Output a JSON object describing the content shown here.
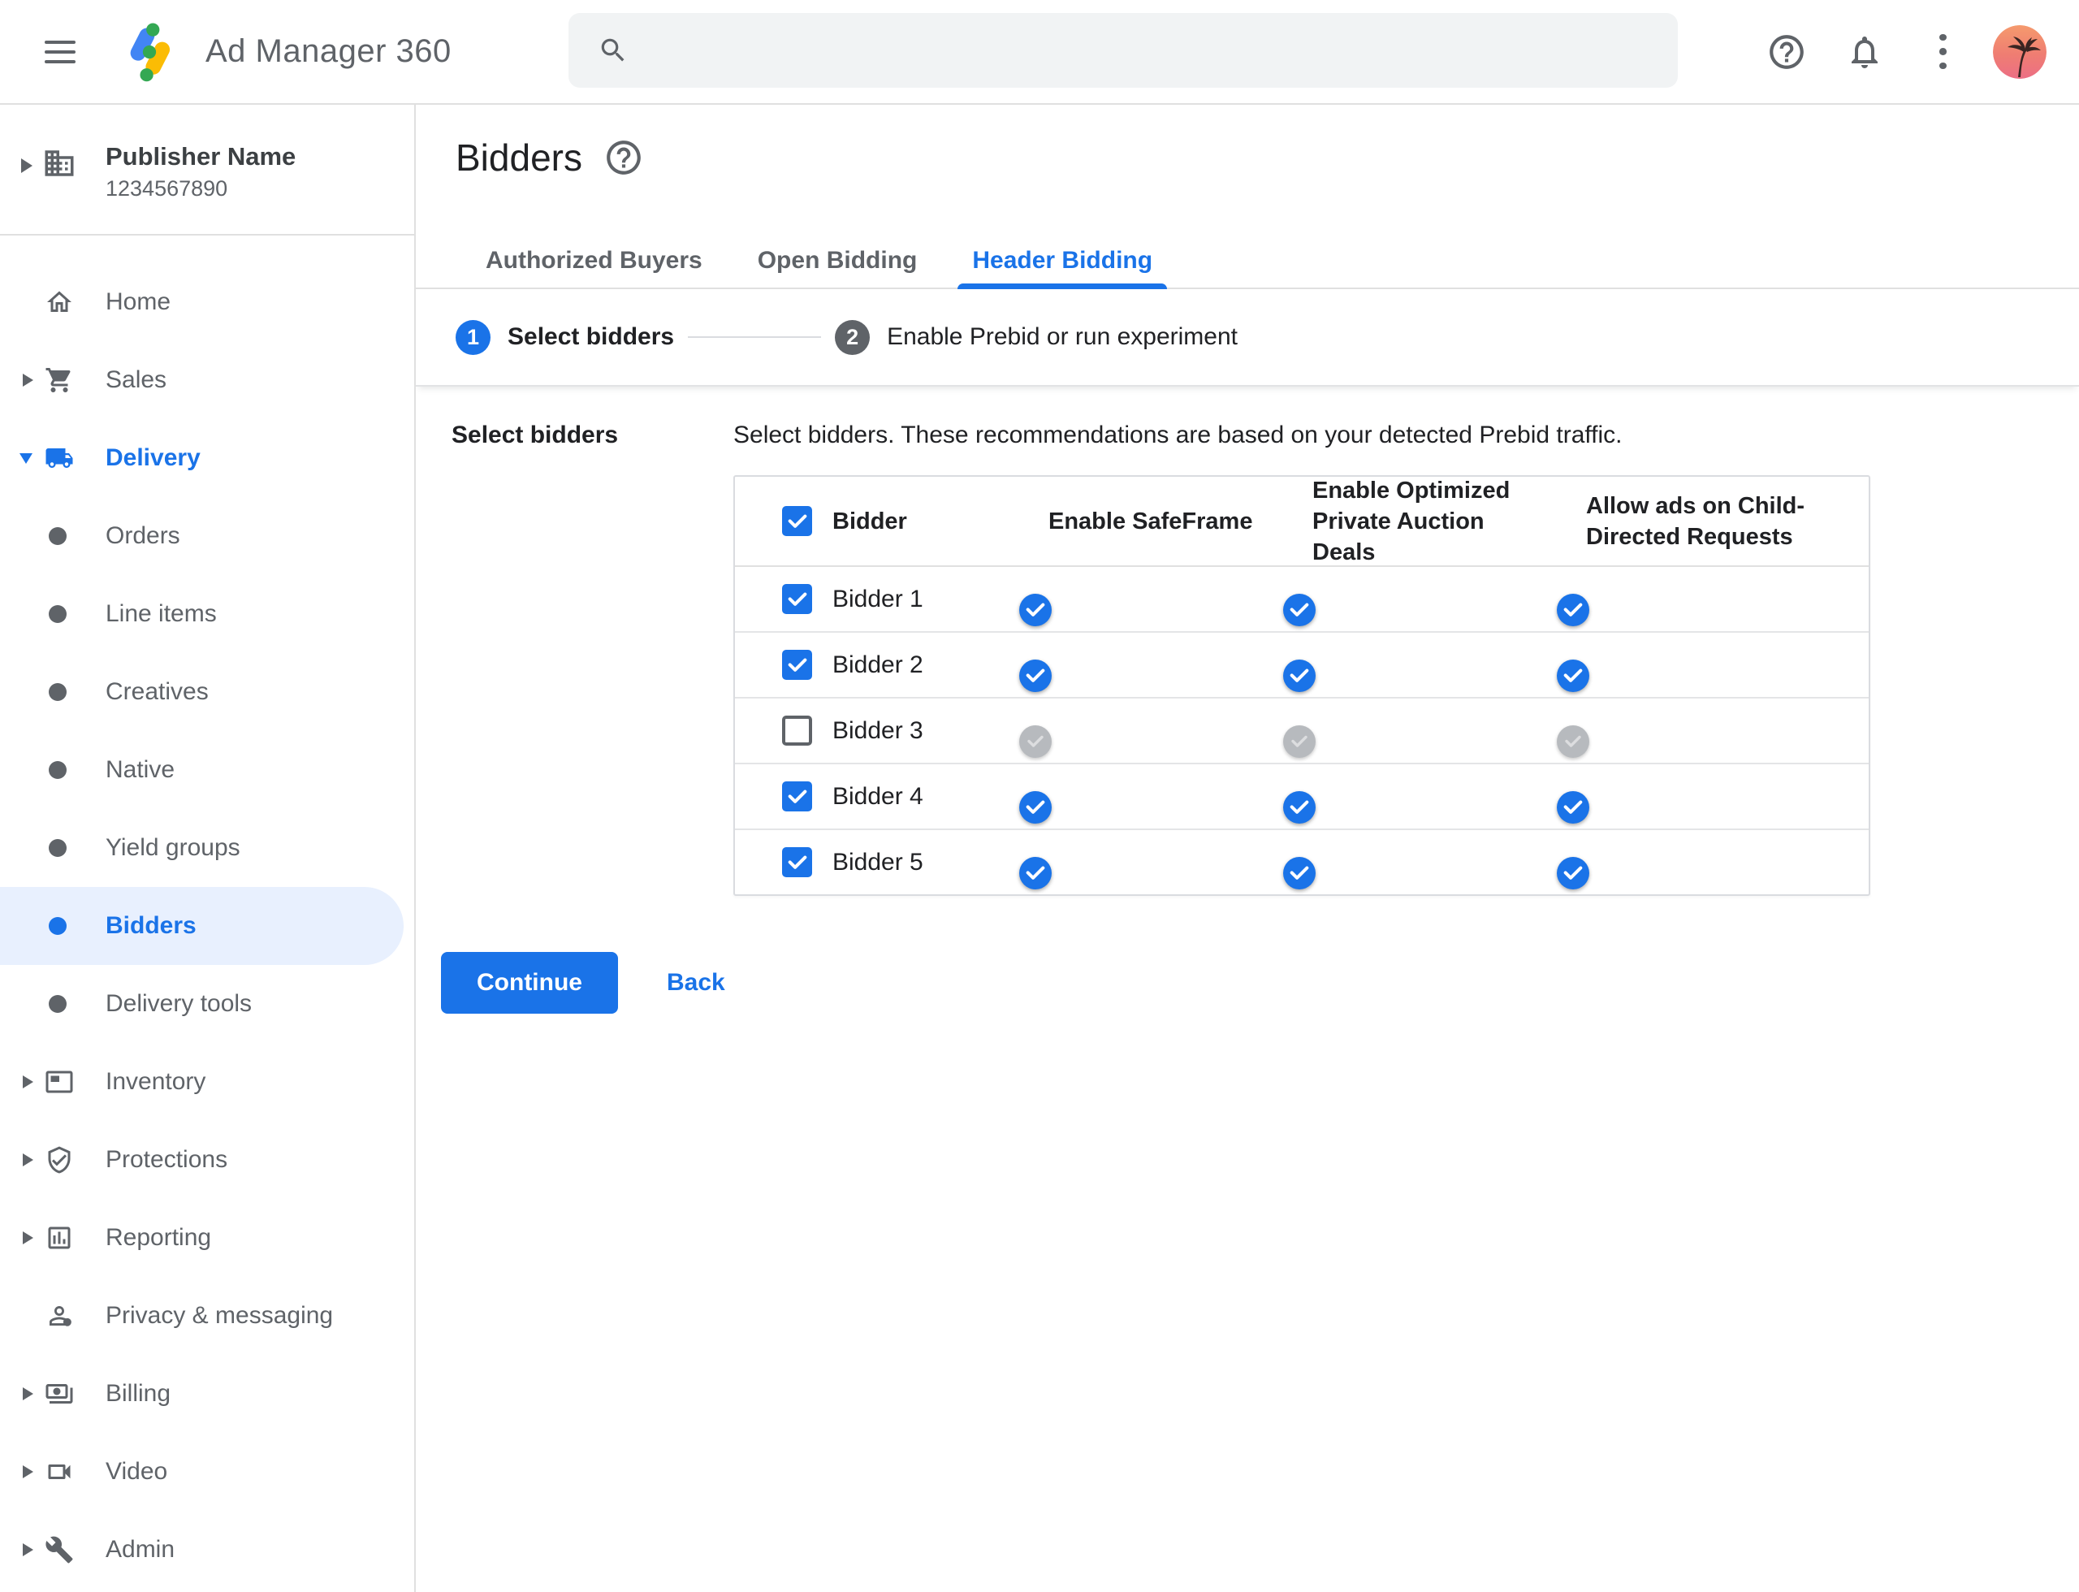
{
  "topbar": {
    "app_title": "Ad Manager 360",
    "search_value": "",
    "icons": [
      "hamburger-menu-icon",
      "ad-manager-logo",
      "search-icon",
      "help-icon",
      "notifications-bell-icon",
      "kebab-menu-icon",
      "palm-tree-avatar"
    ]
  },
  "publisher": {
    "name": "Publisher Name",
    "id": "1234567890",
    "icon": "building-icon"
  },
  "sidebar": {
    "items": [
      {
        "label": "Home",
        "icon": "home-icon",
        "caret": "none",
        "type": "top",
        "active": false,
        "accent": false
      },
      {
        "label": "Sales",
        "icon": "cart-icon",
        "caret": "right",
        "type": "top",
        "active": false,
        "accent": false
      },
      {
        "label": "Delivery",
        "icon": "truck-icon",
        "caret": "down",
        "type": "top",
        "active": false,
        "accent": true
      },
      {
        "label": "Orders",
        "icon": "bullet",
        "caret": "none",
        "type": "sub",
        "active": false,
        "accent": false
      },
      {
        "label": "Line items",
        "icon": "bullet",
        "caret": "none",
        "type": "sub",
        "active": false,
        "accent": false
      },
      {
        "label": "Creatives",
        "icon": "bullet",
        "caret": "none",
        "type": "sub",
        "active": false,
        "accent": false
      },
      {
        "label": "Native",
        "icon": "bullet",
        "caret": "none",
        "type": "sub",
        "active": false,
        "accent": false
      },
      {
        "label": "Yield groups",
        "icon": "bullet",
        "caret": "none",
        "type": "sub",
        "active": false,
        "accent": false
      },
      {
        "label": "Bidders",
        "icon": "bullet",
        "caret": "none",
        "type": "sub",
        "active": true,
        "accent": false
      },
      {
        "label": "Delivery tools",
        "icon": "bullet",
        "caret": "none",
        "type": "sub",
        "active": false,
        "accent": false
      },
      {
        "label": "Inventory",
        "icon": "ad-unit-icon",
        "caret": "right",
        "type": "top",
        "active": false,
        "accent": false
      },
      {
        "label": "Protections",
        "icon": "shield-check-icon",
        "caret": "right",
        "type": "top",
        "active": false,
        "accent": false
      },
      {
        "label": "Reporting",
        "icon": "bar-chart-icon",
        "caret": "right",
        "type": "top",
        "active": false,
        "accent": false
      },
      {
        "label": "Privacy & messaging",
        "icon": "person-badge-icon",
        "caret": "none",
        "type": "top",
        "active": false,
        "accent": false
      },
      {
        "label": "Billing",
        "icon": "payments-icon",
        "caret": "right",
        "type": "top",
        "active": false,
        "accent": false
      },
      {
        "label": "Video",
        "icon": "videocam-icon",
        "caret": "right",
        "type": "top",
        "active": false,
        "accent": false
      },
      {
        "label": "Admin",
        "icon": "wrench-icon",
        "caret": "right",
        "type": "top",
        "active": false,
        "accent": false
      }
    ]
  },
  "page": {
    "title": "Bidders",
    "help_icon": "help-circle-icon"
  },
  "tabs": [
    {
      "label": "Authorized Buyers",
      "active": false
    },
    {
      "label": "Open Bidding",
      "active": false
    },
    {
      "label": "Header Bidding",
      "active": true
    }
  ],
  "stepper": [
    {
      "number": "1",
      "label": "Select bidders",
      "state": "active"
    },
    {
      "number": "2",
      "label": "Enable Prebid or run experiment",
      "state": "upcoming"
    }
  ],
  "content": {
    "section_label": "Select bidders",
    "description": "Select bidders. These recommendations are based on your detected Prebid traffic."
  },
  "table": {
    "header": {
      "select_all_checked": true,
      "columns": [
        "Bidder",
        "Enable SafeFrame",
        "Enable Optimized Private Auction Deals",
        "Allow ads on Child-Directed Requests"
      ]
    },
    "rows": [
      {
        "name": "Bidder 1",
        "checked": true,
        "disabled": false,
        "enable_safeframe": true,
        "enable_optimized_private_auction_deals": true,
        "allow_ads_on_child_directed_requests": true
      },
      {
        "name": "Bidder 2",
        "checked": true,
        "disabled": false,
        "enable_safeframe": true,
        "enable_optimized_private_auction_deals": true,
        "allow_ads_on_child_directed_requests": true
      },
      {
        "name": "Bidder 3",
        "checked": false,
        "disabled": true,
        "enable_safeframe": true,
        "enable_optimized_private_auction_deals": true,
        "allow_ads_on_child_directed_requests": true
      },
      {
        "name": "Bidder 4",
        "checked": true,
        "disabled": false,
        "enable_safeframe": true,
        "enable_optimized_private_auction_deals": true,
        "allow_ads_on_child_directed_requests": true
      },
      {
        "name": "Bidder 5",
        "checked": true,
        "disabled": false,
        "enable_safeframe": true,
        "enable_optimized_private_auction_deals": true,
        "allow_ads_on_child_directed_requests": true
      }
    ]
  },
  "actions": {
    "continue_label": "Continue",
    "back_label": "Back"
  },
  "colors": {
    "accent_blue": "#1a73e8",
    "toggle_track_blue": "#8ab4f8",
    "active_item_bg": "#e8f0fe",
    "text_dark": "#202124",
    "text_gray": "#5f6368",
    "border_gray": "#e0e0e0",
    "disabled_track": "#e9eaec",
    "disabled_thumb": "#b7babe",
    "step_upcoming": "#5f6368",
    "searchbar_bg": "#f1f3f4",
    "logo_blue": "#4285f4",
    "logo_yellow": "#fbbc04",
    "logo_green": "#34a853"
  }
}
